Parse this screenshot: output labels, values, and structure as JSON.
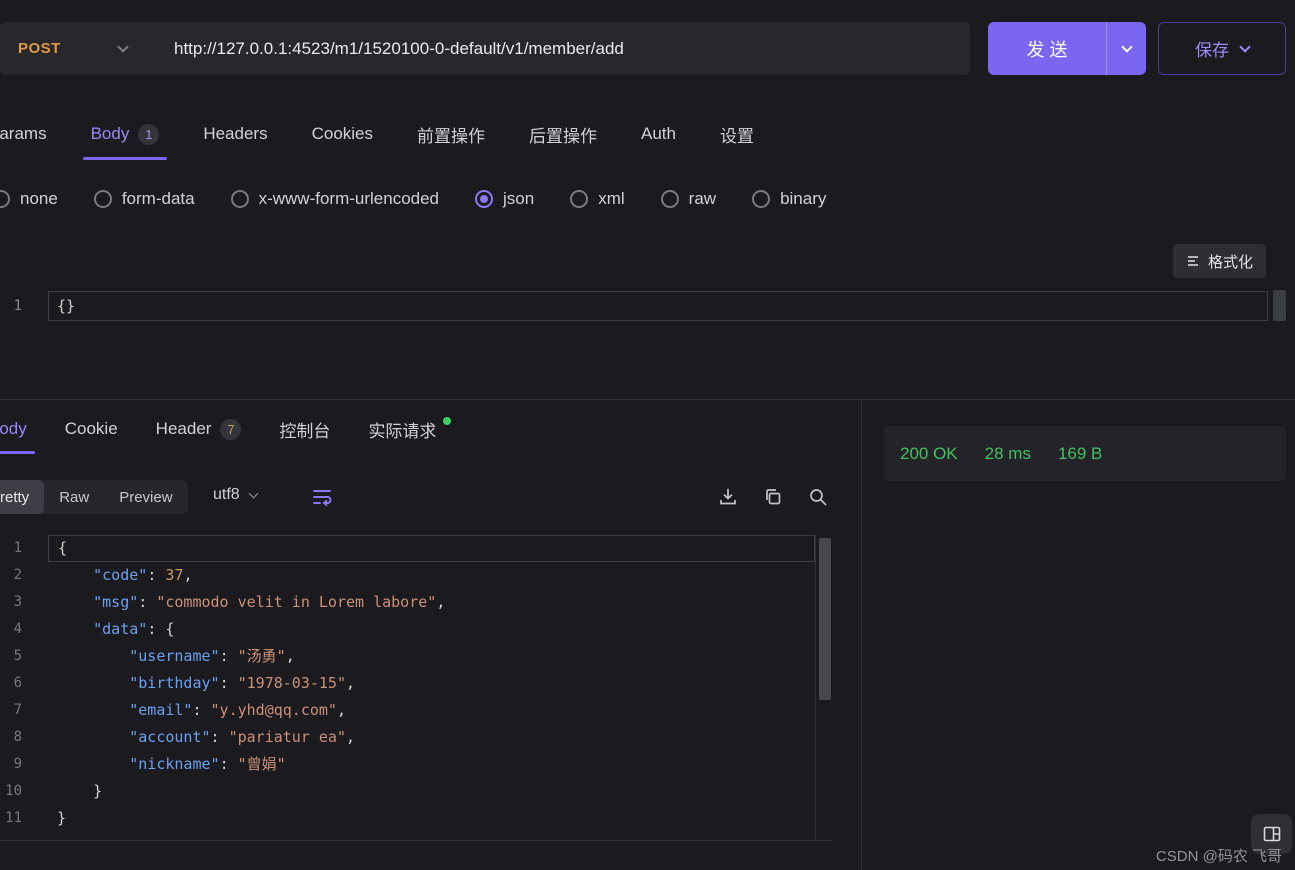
{
  "request_bar": {
    "method": "POST",
    "url": "http://127.0.0.1:4523/m1/1520100-0-default/v1/member/add",
    "send_label": "发 送",
    "save_label": "保存"
  },
  "request_tabs": {
    "params": "Params",
    "body": "Body",
    "body_badge": "1",
    "headers": "Headers",
    "cookies": "Cookies",
    "pre_ops": "前置操作",
    "post_ops": "后置操作",
    "auth": "Auth",
    "settings": "设置"
  },
  "body_types": {
    "none": "none",
    "form_data": "form-data",
    "urlencoded": "x-www-form-urlencoded",
    "json": "json",
    "xml": "xml",
    "raw": "raw",
    "binary": "binary"
  },
  "request_editor": {
    "format_label": "格式化",
    "line_number": "1",
    "content": "{}"
  },
  "response_tabs": {
    "body": "Body",
    "cookie": "Cookie",
    "header": "Header",
    "header_badge": "7",
    "console": "控制台",
    "actual_request": "实际请求"
  },
  "response_meta": {
    "status": "200 OK",
    "time": "28 ms",
    "size": "169 B"
  },
  "response_toolbar": {
    "pretty": "Pretty",
    "raw": "Raw",
    "preview": "Preview",
    "encoding": "utf8"
  },
  "response_json": {
    "lines": [
      {
        "num": "1",
        "tokens": [
          [
            "p",
            "{"
          ]
        ]
      },
      {
        "num": "2",
        "tokens": [
          [
            "p",
            "    "
          ],
          [
            "k",
            "\"code\""
          ],
          [
            "p",
            ": "
          ],
          [
            "n",
            "37"
          ],
          [
            "p",
            ","
          ]
        ]
      },
      {
        "num": "3",
        "tokens": [
          [
            "p",
            "    "
          ],
          [
            "k",
            "\"msg\""
          ],
          [
            "p",
            ": "
          ],
          [
            "s",
            "\"commodo velit in Lorem labore\""
          ],
          [
            "p",
            ","
          ]
        ]
      },
      {
        "num": "4",
        "tokens": [
          [
            "p",
            "    "
          ],
          [
            "k",
            "\"data\""
          ],
          [
            "p",
            ": "
          ],
          [
            "p",
            "{"
          ]
        ]
      },
      {
        "num": "5",
        "tokens": [
          [
            "p",
            "        "
          ],
          [
            "k",
            "\"username\""
          ],
          [
            "p",
            ": "
          ],
          [
            "s",
            "\"汤勇\""
          ],
          [
            "p",
            ","
          ]
        ]
      },
      {
        "num": "6",
        "tokens": [
          [
            "p",
            "        "
          ],
          [
            "k",
            "\"birthday\""
          ],
          [
            "p",
            ": "
          ],
          [
            "s",
            "\"1978-03-15\""
          ],
          [
            "p",
            ","
          ]
        ]
      },
      {
        "num": "7",
        "tokens": [
          [
            "p",
            "        "
          ],
          [
            "k",
            "\"email\""
          ],
          [
            "p",
            ": "
          ],
          [
            "s",
            "\"y.yhd@qq.com\""
          ],
          [
            "p",
            ","
          ]
        ]
      },
      {
        "num": "8",
        "tokens": [
          [
            "p",
            "        "
          ],
          [
            "k",
            "\"account\""
          ],
          [
            "p",
            ": "
          ],
          [
            "s",
            "\"pariatur ea\""
          ],
          [
            "p",
            ","
          ]
        ]
      },
      {
        "num": "9",
        "tokens": [
          [
            "p",
            "        "
          ],
          [
            "k",
            "\"nickname\""
          ],
          [
            "p",
            ": "
          ],
          [
            "s",
            "\"曾娟\""
          ]
        ]
      },
      {
        "num": "10",
        "tokens": [
          [
            "p",
            "    "
          ],
          [
            "p",
            "}"
          ]
        ]
      },
      {
        "num": "11",
        "tokens": [
          [
            "p",
            "}"
          ]
        ]
      }
    ]
  },
  "watermark": "CSDN @码农 飞哥",
  "colors": {
    "accent": "#7a66f0",
    "method": "#e09a45",
    "success": "#43c15e",
    "json_key": "#6ba1f0",
    "json_string": "#ce9178",
    "json_number": "#d19a66"
  }
}
